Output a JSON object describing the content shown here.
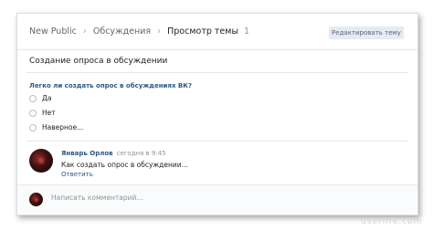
{
  "breadcrumb": {
    "items": [
      "New Public",
      "Обсуждения"
    ],
    "current": "Просмотр темы",
    "count": "1"
  },
  "header": {
    "edit_button_label": "Редактировать тему"
  },
  "topic": {
    "title": "Создание опроса в обсуждении"
  },
  "poll": {
    "question": "Легко ли создать опрос в обсуждениях ВК?",
    "options": [
      "Да",
      "Нет",
      "Наверное..."
    ]
  },
  "comment": {
    "author": "Январь Орлов",
    "time": "сегодня в 9:45",
    "text": "Как создать опрос в обсуждении...",
    "reply_label": "Ответить"
  },
  "footer": {
    "comment_placeholder": "Написать комментарий..."
  },
  "watermark": "userlife.com",
  "colors": {
    "link": "#2a5885",
    "button_bg": "#e5ebf1",
    "divider": "#e7e8ec"
  }
}
